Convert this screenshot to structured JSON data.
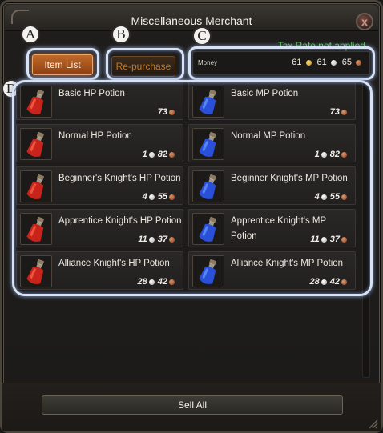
{
  "window": {
    "title": "Miscellaneous Merchant",
    "close_glyph": "x"
  },
  "markers": [
    "A",
    "B",
    "C",
    "D"
  ],
  "tabs": {
    "item_list": "Item List",
    "repurchase": "Re-purchase"
  },
  "tax_note": "Tax Rate not applied",
  "money": {
    "label": "Money",
    "gold": "61",
    "silver": "61",
    "copper": "65"
  },
  "items": [
    {
      "name": "Basic HP Potion",
      "silver": "",
      "copper": "73",
      "potion": "red"
    },
    {
      "name": "Basic MP Potion",
      "silver": "",
      "copper": "73",
      "potion": "blue"
    },
    {
      "name": "Normal HP Potion",
      "silver": "1",
      "copper": "82",
      "potion": "red"
    },
    {
      "name": "Normal MP Potion",
      "silver": "1",
      "copper": "82",
      "potion": "blue"
    },
    {
      "name": "Beginner's Knight's HP Potion",
      "silver": "4",
      "copper": "55",
      "potion": "red"
    },
    {
      "name": "Beginner Knight's MP Potion",
      "silver": "4",
      "copper": "55",
      "potion": "blue"
    },
    {
      "name": "Apprentice Knight's HP Potion",
      "silver": "11",
      "copper": "37",
      "potion": "red"
    },
    {
      "name": "Apprentice Knight's MP Potion",
      "silver": "11",
      "copper": "37",
      "potion": "blue"
    },
    {
      "name": "Alliance Knight's HP Potion",
      "silver": "28",
      "copper": "42",
      "potion": "red"
    },
    {
      "name": "Alliance Knight's MP Potion",
      "silver": "28",
      "copper": "42",
      "potion": "blue"
    }
  ],
  "sell_all": "Sell All",
  "colors": {
    "tax_note": "#4fd24a",
    "tab_active": "#c06a2a",
    "highlight": "#d9e2f2",
    "hp_potion": "#c8241c",
    "mp_potion": "#2a4fd8"
  }
}
